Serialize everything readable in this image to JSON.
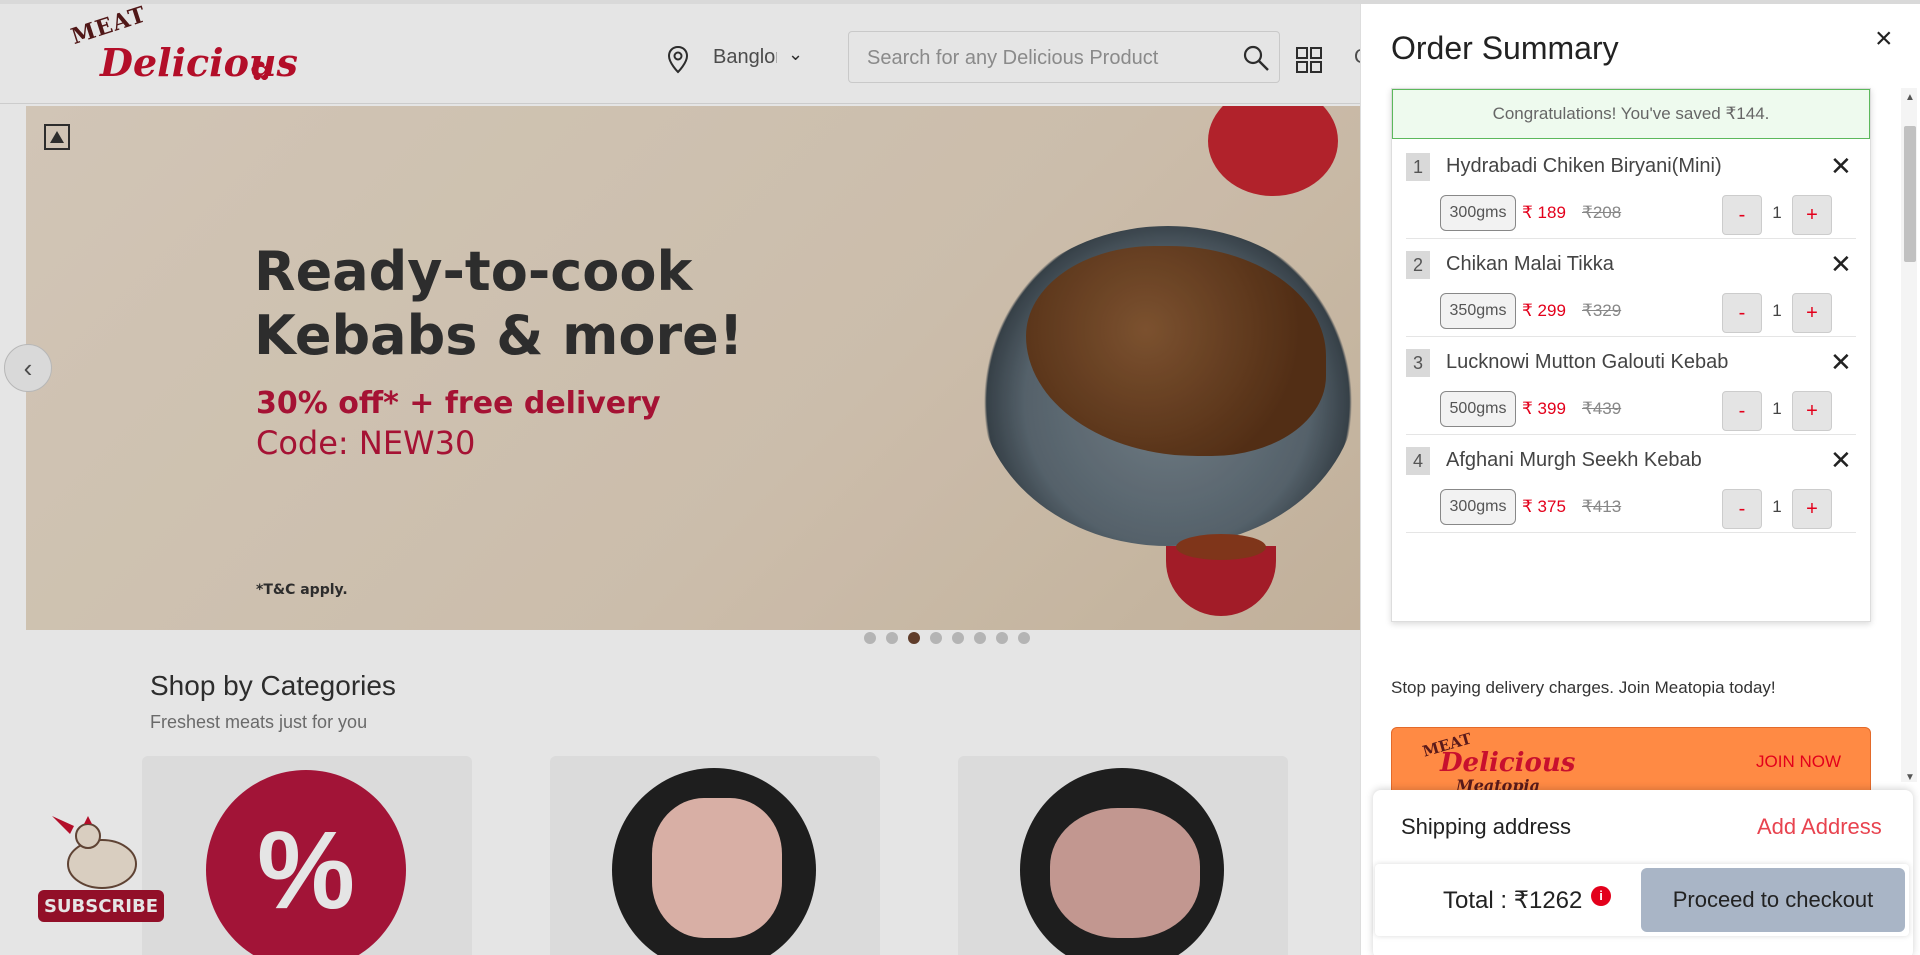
{
  "header": {
    "logo_top": "MEAT",
    "logo_main": "Delicious",
    "location": "Banglore",
    "search_placeholder": "Search for any Delicious Product",
    "extra": "C"
  },
  "banner": {
    "title_line1": "Ready-to-cook",
    "title_line2": "Kebabs & more!",
    "offer": "30% off* + free delivery",
    "code": "Code: NEW30",
    "tc": "*T&C apply.",
    "dots": 8,
    "active_dot": 3
  },
  "categories": {
    "title": "Shop by Categories",
    "subtitle": "Freshest meats just for you",
    "badge_symbol": "%"
  },
  "subscribe_label": "SUBSCRIBE",
  "order_summary": {
    "title": "Order Summary",
    "close_symbol": "×",
    "congrats": "Congratulations! You've saved ₹144.",
    "items": [
      {
        "num": "1",
        "name": "Hydrabadi Chiken Biryani(Mini)",
        "weight": "300gms",
        "price": "₹ 189",
        "mrp": "₹208",
        "qty": "1"
      },
      {
        "num": "2",
        "name": "Chikan Malai Tikka",
        "weight": "350gms",
        "price": "₹ 299",
        "mrp": "₹329",
        "qty": "1"
      },
      {
        "num": "3",
        "name": "Lucknowi Mutton Galouti Kebab",
        "weight": "500gms",
        "price": "₹ 399",
        "mrp": "₹439",
        "qty": "1"
      },
      {
        "num": "4",
        "name": "Afghani Murgh Seekh Kebab",
        "weight": "300gms",
        "price": "₹ 375",
        "mrp": "₹413",
        "qty": "1"
      }
    ],
    "minus": "-",
    "plus": "+",
    "remove": "✕",
    "meatopia_text": "Stop paying delivery charges. Join Meatopia today!",
    "meatopia_logo_top": "MEAT",
    "meatopia_logo_main": "Delicious",
    "meatopia_logo_sub": "Meatopia",
    "join_label": "JOIN NOW",
    "shipping_label": "Shipping address",
    "add_address": "Add Address",
    "total": "Total : ₹1262",
    "info_symbol": "i",
    "checkout": "Proceed to checkout"
  },
  "colors": {
    "brand_red": "#c8102e",
    "price_red": "#e3001b",
    "join_orange": "#ff8a44",
    "checkout_grey": "#a9b5c6",
    "congrats_green": "#5cb85c"
  }
}
